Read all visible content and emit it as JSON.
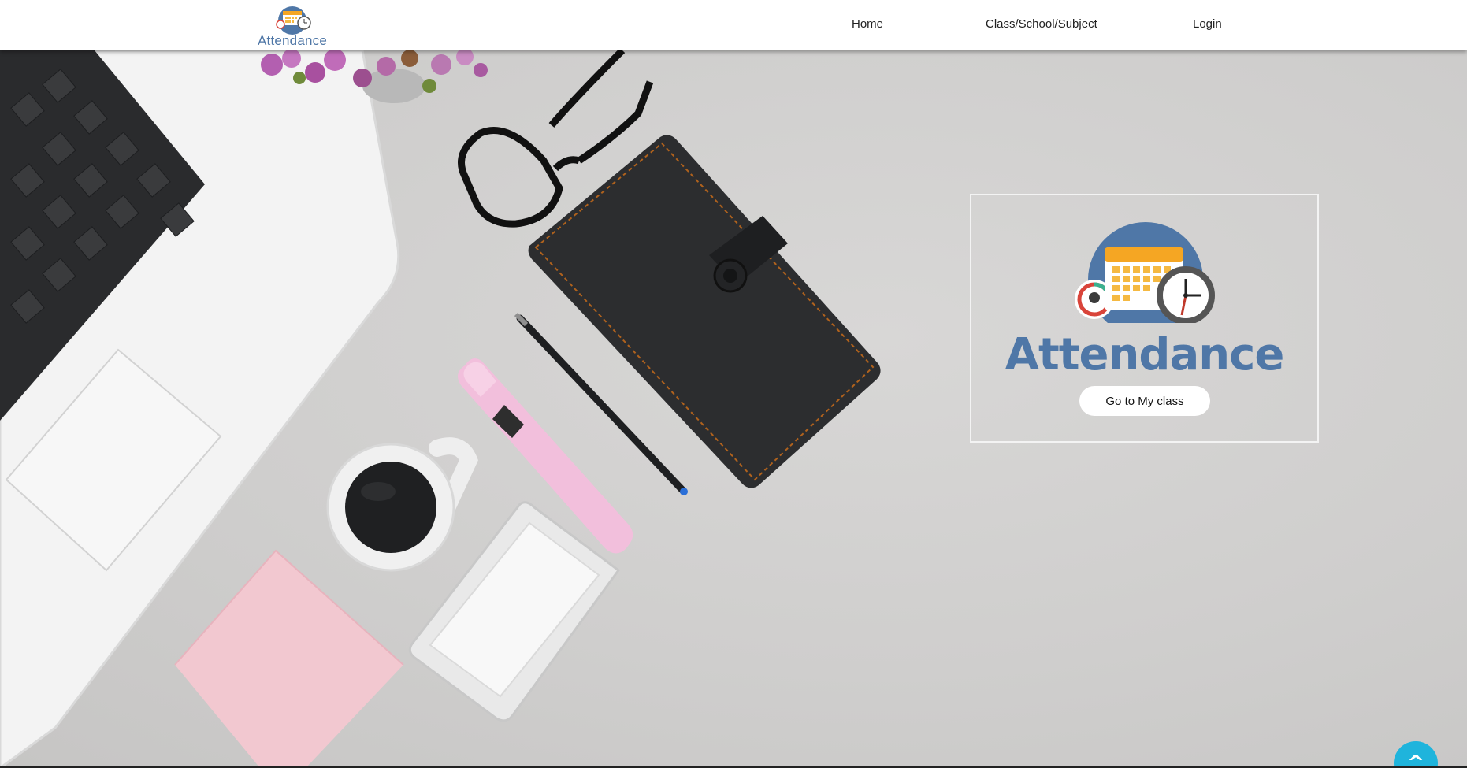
{
  "brand": {
    "name": "Attendance"
  },
  "nav": {
    "home": "Home",
    "class_school_subject": "Class/School/Subject",
    "login": "Login"
  },
  "hero": {
    "title": "Attendance",
    "button_label": "Go to My class"
  },
  "scroll_top": {
    "label": "^",
    "icon": "arrow-up-icon"
  },
  "colors": {
    "brand_blue": "#4f77a7",
    "accent_cyan": "#1fb4dc",
    "calendar_orange": "#f5a623",
    "background_gray": "#cfcecd"
  }
}
